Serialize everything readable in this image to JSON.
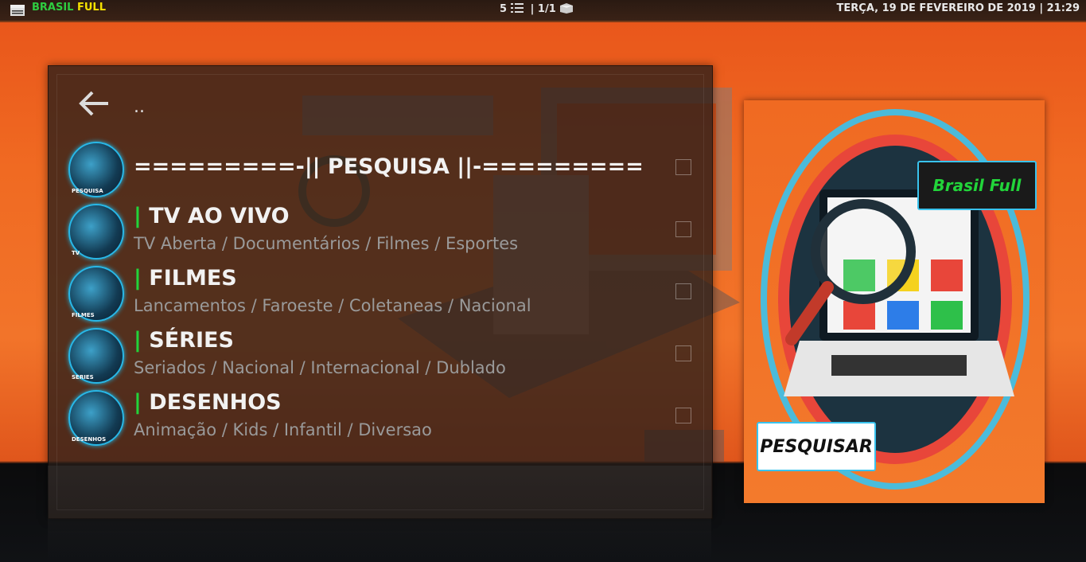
{
  "topbar": {
    "brand_part1": "BRASIL",
    "brand_part2": "FULL",
    "item_count": "5",
    "page": "| 1/1",
    "datetime": "TERÇA, 19 DE FEVEREIRO DE 2019 | 21:29"
  },
  "list": {
    "parent": "..",
    "items": [
      {
        "title": "=========-|| PESQUISA ||-=========",
        "subtitle": "",
        "thumb_label": "PESQUISA",
        "marker": ""
      },
      {
        "title": "TV AO VIVO",
        "subtitle": "TV Aberta / Documentários / Filmes / Esportes",
        "thumb_label": "TV",
        "marker": "|"
      },
      {
        "title": "FILMES",
        "subtitle": "Lancamentos / Faroeste / Coletaneas / Nacional",
        "thumb_label": "FILMES",
        "marker": "|"
      },
      {
        "title": "SÉRIES",
        "subtitle": "Seriados / Nacional / Internacional / Dublado",
        "thumb_label": "SERIES",
        "marker": "|"
      },
      {
        "title": "DESENHOS",
        "subtitle": "Animação / Kids / Infantil / Diversao",
        "thumb_label": "DESENHOS",
        "marker": "|"
      }
    ]
  },
  "poster": {
    "brand_label": "Brasil Full",
    "action_label": "PESQUISAR"
  },
  "colors": {
    "accent_green": "#22d43a",
    "brand_yellow": "#f5e100",
    "glow_blue": "#39c3ee",
    "background_orange": "#f06a22"
  }
}
